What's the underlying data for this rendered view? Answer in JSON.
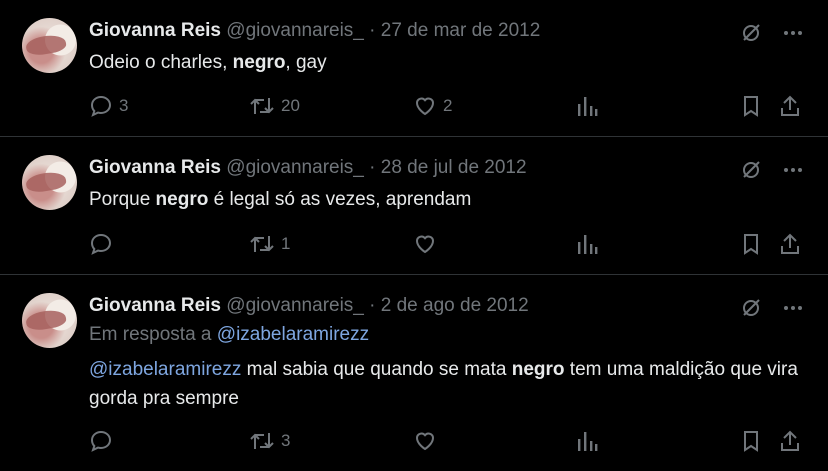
{
  "tweets": [
    {
      "name": "Giovanna Reis",
      "handle": "@giovannareis_",
      "sep": "·",
      "date": "27 de mar de 2012",
      "text_before": "Odeio o charles, ",
      "text_bold": "negro",
      "text_after": ", gay",
      "reply_count": "3",
      "retweet_count": "20",
      "like_count": "2"
    },
    {
      "name": "Giovanna Reis",
      "handle": "@giovannareis_",
      "sep": "·",
      "date": "28 de jul de 2012",
      "text_before": "Porque ",
      "text_bold": "negro",
      "text_after": " é legal só as vezes, aprendam",
      "reply_count": "",
      "retweet_count": "1",
      "like_count": ""
    },
    {
      "name": "Giovanna Reis",
      "handle": "@giovannareis_",
      "sep": "·",
      "date": "2 de ago de 2012",
      "reply_prefix": "Em resposta a ",
      "reply_to": "@izabelaramirezz",
      "mention": "@izabelaramirezz",
      "text_before": " mal sabia que quando se mata ",
      "text_bold": "negro",
      "text_after": " tem uma maldição que vira gorda pra sempre",
      "reply_count": "",
      "retweet_count": "3",
      "like_count": ""
    }
  ],
  "colors": {
    "background": "#000000",
    "text": "#e7e9ea",
    "muted": "#71767b",
    "link": "#7ea6e0",
    "divider": "#2f3336"
  },
  "icons": [
    "grok-icon",
    "more-icon",
    "reply-icon",
    "retweet-icon",
    "like-icon",
    "views-icon",
    "bookmark-icon",
    "share-icon"
  ]
}
